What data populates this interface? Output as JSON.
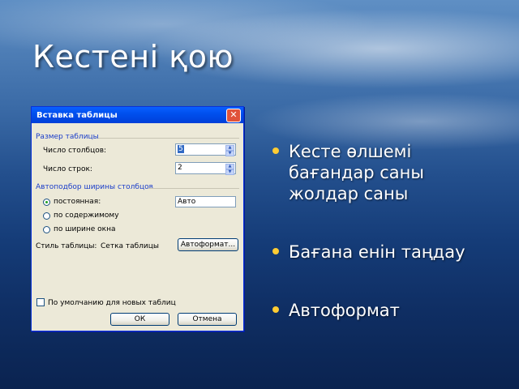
{
  "slide": {
    "title": "Кестені қою",
    "bullets": [
      [
        "Кесте өлшемі",
        "бағандар саны",
        "жолдар саны"
      ],
      [
        "Бағана енін таңдау"
      ],
      [
        "Автоформат"
      ]
    ]
  },
  "dialog": {
    "title": "Вставка таблицы",
    "close_label": "✕",
    "size_group": "Размер таблицы",
    "columns_label": "Число столбцов:",
    "columns_value": "5",
    "rows_label": "Число строк:",
    "rows_value": "2",
    "autofit_group": "Автоподбор ширины столбцов",
    "radio_fixed": "постоянная:",
    "radio_fixed_value": "Авто",
    "radio_content": "по содержимому",
    "radio_window": "по ширине окна",
    "style_label": "Стиль таблицы:",
    "style_value": "Сетка таблицы",
    "autoformat_button": "Автоформат...",
    "default_checkbox": "По умолчанию для новых таблиц",
    "ok_button": "ОК",
    "cancel_button": "Отмена"
  }
}
